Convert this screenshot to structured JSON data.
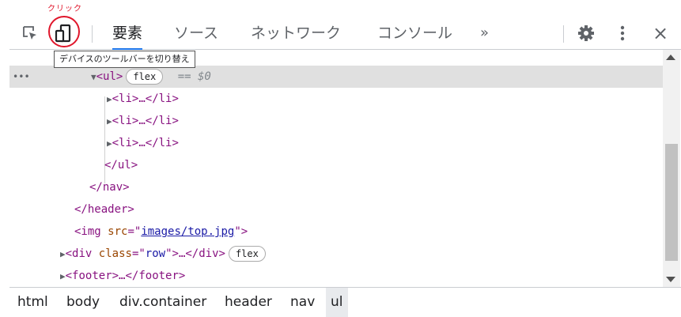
{
  "annotation": "クリック",
  "tooltip": "デバイスのツールバーを切り替え",
  "toolbar": {
    "tabs": [
      {
        "label": "要素",
        "active": true
      },
      {
        "label": "ソース",
        "active": false
      },
      {
        "label": "ネットワーク",
        "active": false
      },
      {
        "label": "コンソール",
        "active": false
      }
    ],
    "more": "»",
    "close": "×"
  },
  "tree": {
    "ul": {
      "open": "<ul>",
      "badge": "flex",
      "eq": "== ",
      "ref": "$0"
    },
    "li": "<li>…</li>",
    "ul_close": "</ul>",
    "nav_close": "</nav>",
    "header_close": "</header>",
    "img": {
      "tag": "<img",
      "attr": "src",
      "eq": "=\"",
      "value": "images/top.jpg",
      "end": "\">"
    },
    "div": {
      "tag": "<div",
      "attr": "class",
      "eq": "=\"",
      "value": "row",
      "end": "\">…</div>",
      "badge": "flex"
    },
    "footer": "<footer>…</footer>",
    "dots": "•••"
  },
  "breadcrumbs": [
    "html",
    "body",
    "div.container",
    "header",
    "nav",
    "ul"
  ],
  "colors": {
    "accent": "#1a73e8",
    "annotation": "#e0162b",
    "tag": "#881280",
    "attr": "#994500",
    "value": "#1a1aa6"
  }
}
